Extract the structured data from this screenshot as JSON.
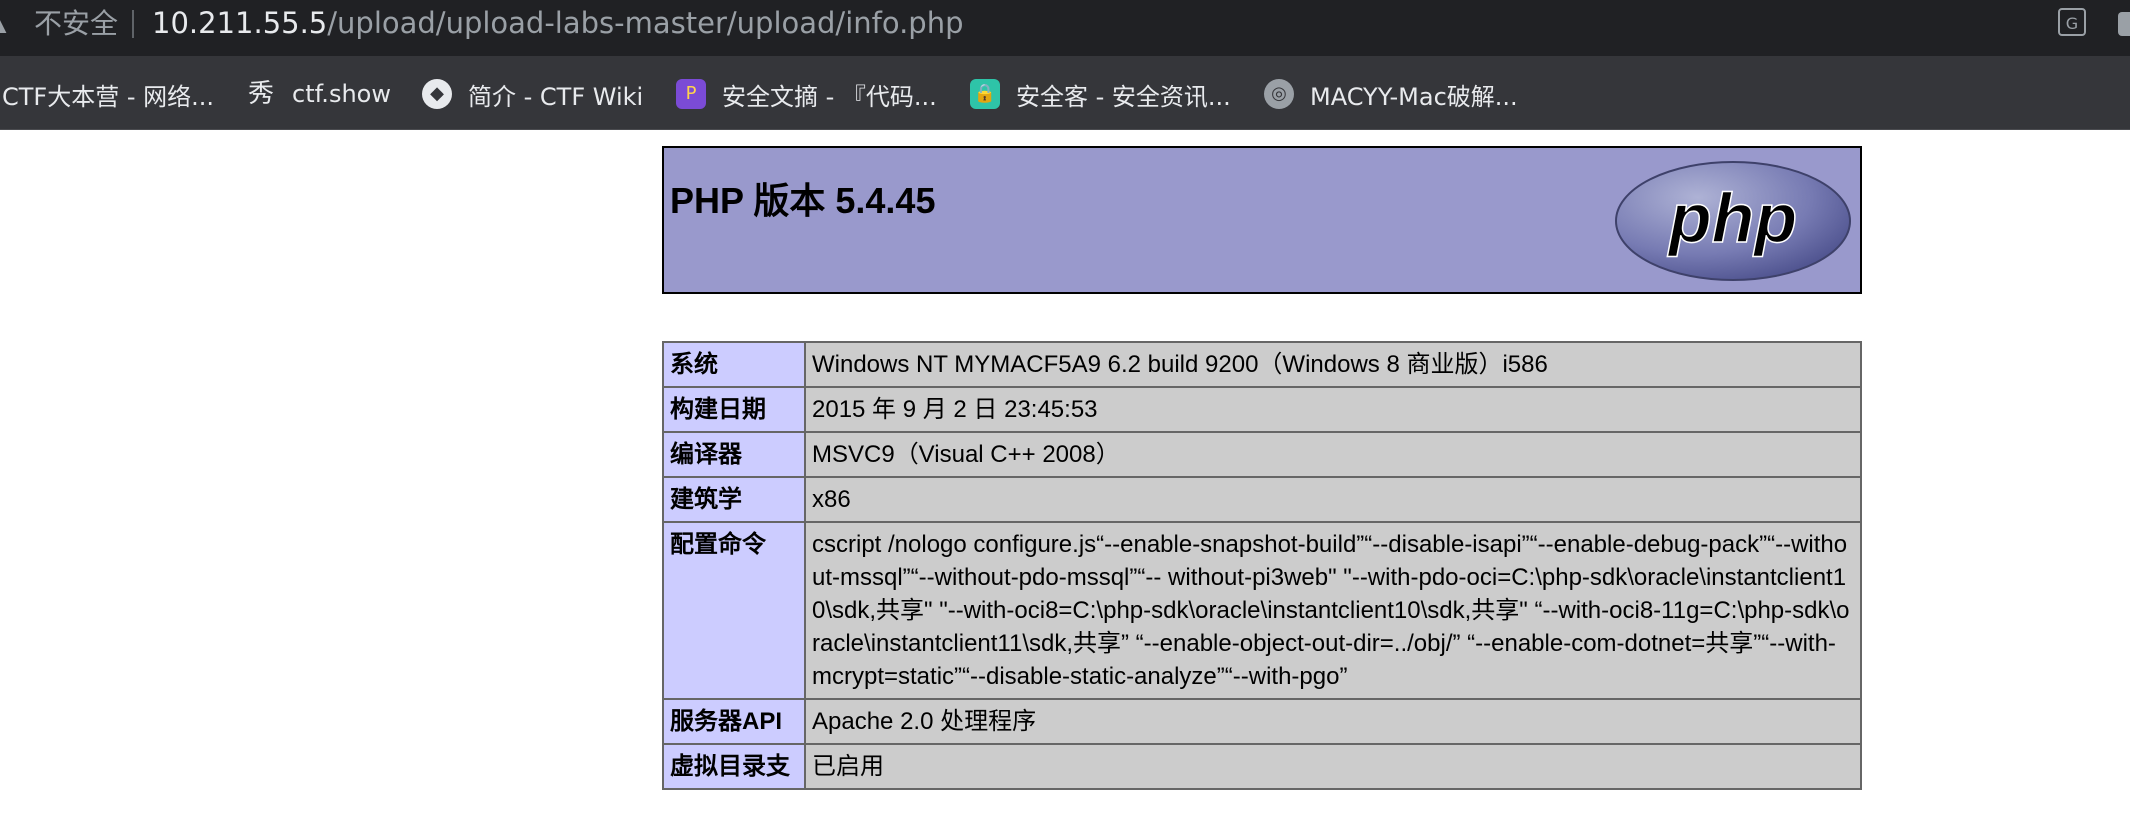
{
  "browser": {
    "security_label": "不安全",
    "url_host": "10.211.55.5",
    "url_path": "/upload/upload-labs-master/upload/info.php",
    "icons": {
      "warning": "warning-icon",
      "translate": "translate-icon",
      "profile": "profile-icon"
    }
  },
  "bookmarks": [
    {
      "label": "CTF大本营 - 网络...",
      "icon": "ctf-icon"
    },
    {
      "label": "ctf.show",
      "icon": "ctfshow-icon"
    },
    {
      "label": "简介 - CTF Wiki",
      "icon": "ctf-wiki-icon"
    },
    {
      "label": "安全文摘 - 『代码...",
      "icon": "wenzhai-icon"
    },
    {
      "label": "安全客 - 安全资讯...",
      "icon": "anquanke-icon"
    },
    {
      "label": "MACYY-Mac破解...",
      "icon": "globe-icon"
    }
  ],
  "phpinfo": {
    "title": "PHP 版本 5.4.45",
    "logo_text": "php",
    "rows": [
      {
        "key": "系统",
        "value": "Windows NT MYMACF5A9 6.2 build 9200（Windows 8 商业版）i586"
      },
      {
        "key": "构建日期",
        "value": "2015 年 9 月 2 日 23:45:53"
      },
      {
        "key": "编译器",
        "value": "MSVC9（Visual C++ 2008）"
      },
      {
        "key": "建筑学",
        "value": "x86"
      },
      {
        "key": "配置命令",
        "value": "cscript /nologo configure.js“--enable-snapshot-build”“--disable-isapi”“--enable-debug-pack”“--without-mssql”“--without-pdo-mssql”“-- without-pi3web\" \"--with-pdo-oci=C:\\php-sdk\\oracle\\instantclient10\\sdk,共享\" \"--with-oci8=C:\\php-sdk\\oracle\\instantclient10\\sdk,共享\" “--with-oci8-11g=C:\\php-sdk\\oracle\\instantclient11\\sdk,共享” “--enable-object-out-dir=../obj/” “--enable-com-dotnet=共享”“--with-mcrypt=static”“--disable-static-analyze”“--with-pgo”"
      },
      {
        "key": "服务器API",
        "value": "Apache 2.0 处理程序"
      },
      {
        "key": "虚拟目录支",
        "value": "已启用"
      }
    ]
  },
  "colors": {
    "header_bg": "#9999cc",
    "key_bg": "#ccccff",
    "value_bg": "#cccccc",
    "chrome_dark": "#202124",
    "bookmarks_bg": "#35363a"
  }
}
